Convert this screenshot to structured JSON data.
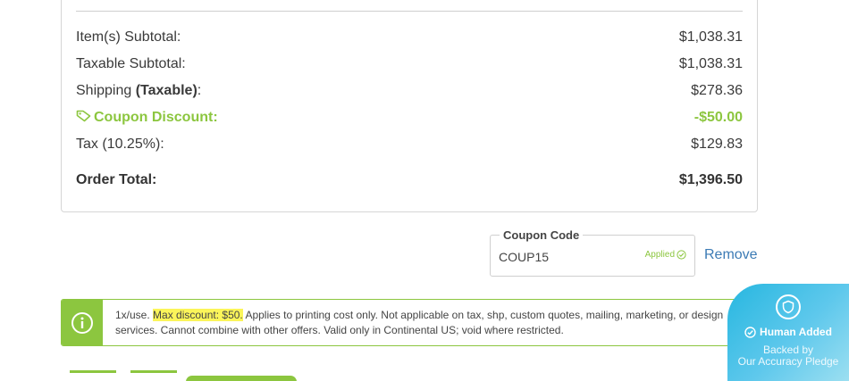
{
  "summary": {
    "rows": [
      {
        "label": "Item(s) Subtotal:",
        "value": "$1,038.31"
      },
      {
        "label": "Taxable Subtotal:",
        "value": "$1,038.31"
      },
      {
        "label_prefix": "Shipping ",
        "label_bold": "(Taxable)",
        "label_suffix": ":",
        "value": "$278.36"
      },
      {
        "label": "Coupon Discount:",
        "value": "-$50.00"
      },
      {
        "label": "Tax (10.25%):",
        "value": "$129.83"
      }
    ],
    "total": {
      "label": "Order Total:",
      "value": "$1,396.50"
    }
  },
  "coupon": {
    "legend": "Coupon Code",
    "code": "COUP15",
    "status": "Applied",
    "remove_label": "Remove"
  },
  "notice": {
    "prefix": "1x/use. ",
    "highlight": "Max discount: $50.",
    "rest": " Applies to printing cost only. Not applicable on tax, shp, custom quotes, mailing, marketing, or design services. Cannot combine with other offers. Valid only in Continental US; void where restricted."
  },
  "badge": {
    "title": "Human Added",
    "line1": "Backed by",
    "line2": "Our Accuracy Pledge"
  },
  "colors": {
    "accent_green": "#8cc63f",
    "link_blue": "#3c7bb5",
    "highlight_yellow": "#fbf55a",
    "badge_blue": "#27b7e0"
  },
  "icons": [
    "tag-icon",
    "check-circle-icon",
    "info-icon",
    "shield-icon"
  ]
}
